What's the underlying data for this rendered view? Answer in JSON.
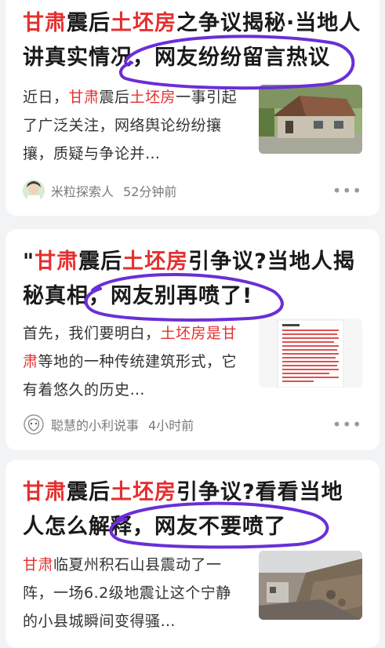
{
  "articles": [
    {
      "title_parts": [
        {
          "text": "甘肃",
          "hl": true
        },
        {
          "text": "震后",
          "hl": false
        },
        {
          "text": "土坯房",
          "hl": true
        },
        {
          "text": "之争议揭秘·当地人讲真实情况，网友纷纷留言热议",
          "hl": false
        }
      ],
      "snippet_parts": [
        {
          "text": "近日，",
          "hl": false
        },
        {
          "text": "甘肃",
          "hl": true
        },
        {
          "text": "震后",
          "hl": false
        },
        {
          "text": "土坯房",
          "hl": true
        },
        {
          "text": "一事引起了广泛关注，网络舆论纷纷攘攘，质疑与争论并…",
          "hl": false
        }
      ],
      "author": "米粒探索人",
      "time": "52分钟前"
    },
    {
      "title_parts": [
        {
          "text": "\"",
          "hl": false
        },
        {
          "text": "甘肃",
          "hl": true
        },
        {
          "text": "震后",
          "hl": false
        },
        {
          "text": "土坯房",
          "hl": true
        },
        {
          "text": "引争议?当地人揭秘真相，网友别再喷了!",
          "hl": false
        }
      ],
      "snippet_parts": [
        {
          "text": "首先，我们要明白，",
          "hl": false
        },
        {
          "text": "土坯房是甘肃",
          "hl": true
        },
        {
          "text": "等地的一种传统建筑形式，它有着悠久的历史…",
          "hl": false
        }
      ],
      "author": "聪慧的小利说事",
      "time": "4小时前"
    },
    {
      "title_parts": [
        {
          "text": "甘肃",
          "hl": true
        },
        {
          "text": "震后",
          "hl": false
        },
        {
          "text": "土坯房",
          "hl": true
        },
        {
          "text": "引争议?看看当地人怎么解释，网友不要喷了",
          "hl": false
        }
      ],
      "snippet_parts": [
        {
          "text": "甘肃",
          "hl": true
        },
        {
          "text": "临夏州积石山县震动了一阵，一场6.2级地震让这个宁静的小县城瞬间变得骚…",
          "hl": false
        }
      ]
    }
  ],
  "more_icon": "more-dots",
  "colors": {
    "highlight": "#e5302f",
    "annotation": "#6a2fd6"
  }
}
